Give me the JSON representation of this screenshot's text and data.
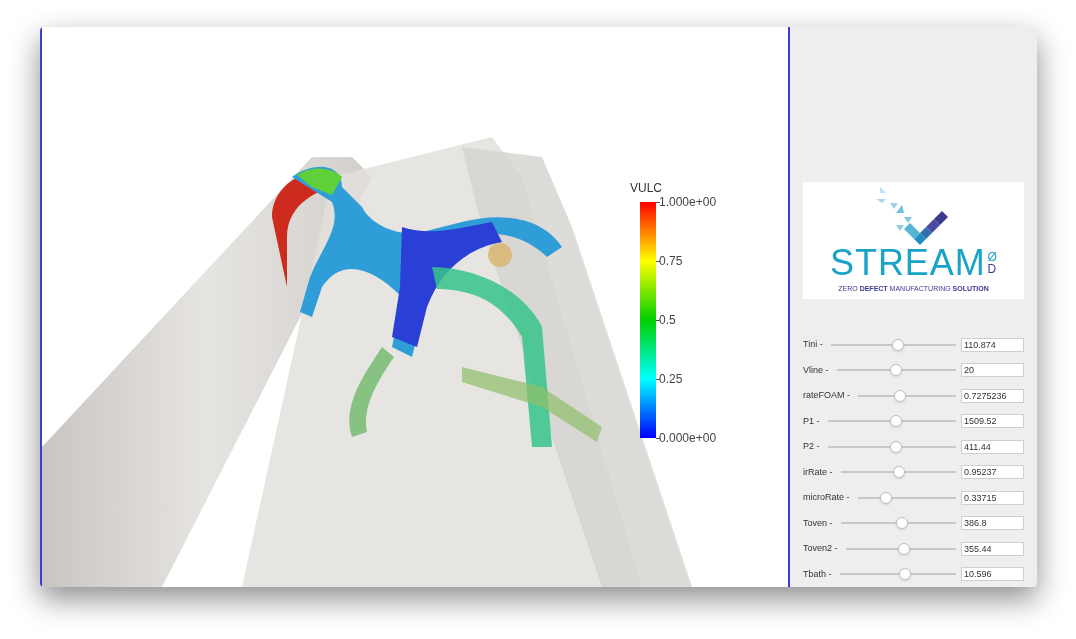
{
  "viewport": {
    "colorbar": {
      "title": "VULC",
      "labels": [
        "1.000e+00",
        "0.75",
        "0.5",
        "0.25",
        "0.000e+00"
      ]
    }
  },
  "logo": {
    "name": "STREAM",
    "mark_top": "Ø",
    "mark_bottom": "D",
    "tagline": "ZERO **DEFECT** MANUFACTURING **SOLUTION**"
  },
  "parameters": [
    {
      "label": "Tini -",
      "level": 0.54,
      "value": "110.874"
    },
    {
      "label": "Vline -",
      "level": 0.5,
      "value": "20"
    },
    {
      "label": "rateFOAM -",
      "level": 0.43,
      "value": "0.7275236"
    },
    {
      "label": "P1 -",
      "level": 0.53,
      "value": "1509.52"
    },
    {
      "label": "P2 -",
      "level": 0.53,
      "value": "411.44"
    },
    {
      "label": "irRate -",
      "level": 0.51,
      "value": "0.95237"
    },
    {
      "label": "microRate -",
      "level": 0.29,
      "value": "0.33715"
    },
    {
      "label": "Toven -",
      "level": 0.53,
      "value": "386.8"
    },
    {
      "label": "Toven2 -",
      "level": 0.53,
      "value": "355.44"
    },
    {
      "label": "Tbath -",
      "level": 0.56,
      "value": "10.596"
    }
  ]
}
